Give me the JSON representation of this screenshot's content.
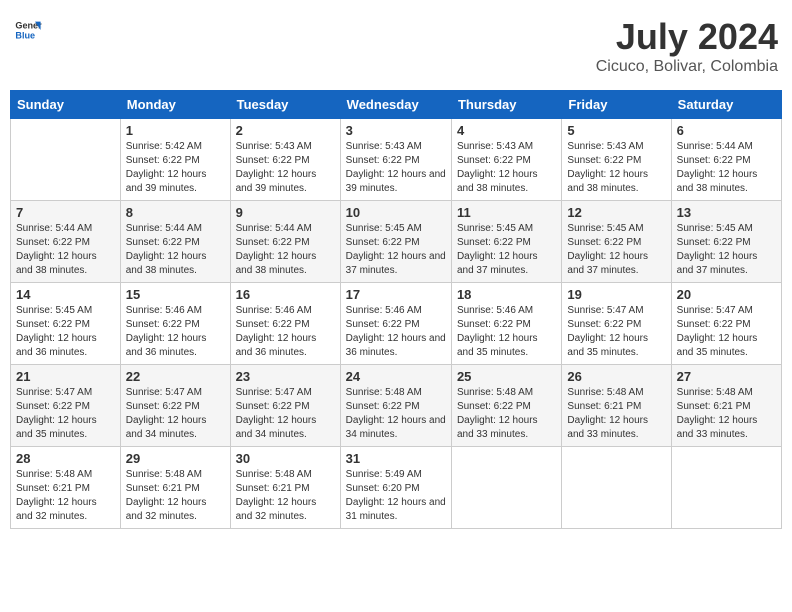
{
  "header": {
    "logo_general": "General",
    "logo_blue": "Blue",
    "month_year": "July 2024",
    "location": "Cicuco, Bolivar, Colombia"
  },
  "calendar": {
    "days_of_week": [
      "Sunday",
      "Monday",
      "Tuesday",
      "Wednesday",
      "Thursday",
      "Friday",
      "Saturday"
    ],
    "weeks": [
      [
        {
          "day": "",
          "info": ""
        },
        {
          "day": "1",
          "info": "Sunrise: 5:42 AM\nSunset: 6:22 PM\nDaylight: 12 hours\nand 39 minutes."
        },
        {
          "day": "2",
          "info": "Sunrise: 5:43 AM\nSunset: 6:22 PM\nDaylight: 12 hours\nand 39 minutes."
        },
        {
          "day": "3",
          "info": "Sunrise: 5:43 AM\nSunset: 6:22 PM\nDaylight: 12 hours\nand 39 minutes."
        },
        {
          "day": "4",
          "info": "Sunrise: 5:43 AM\nSunset: 6:22 PM\nDaylight: 12 hours\nand 38 minutes."
        },
        {
          "day": "5",
          "info": "Sunrise: 5:43 AM\nSunset: 6:22 PM\nDaylight: 12 hours\nand 38 minutes."
        },
        {
          "day": "6",
          "info": "Sunrise: 5:44 AM\nSunset: 6:22 PM\nDaylight: 12 hours\nand 38 minutes."
        }
      ],
      [
        {
          "day": "7",
          "info": "Sunrise: 5:44 AM\nSunset: 6:22 PM\nDaylight: 12 hours\nand 38 minutes."
        },
        {
          "day": "8",
          "info": "Sunrise: 5:44 AM\nSunset: 6:22 PM\nDaylight: 12 hours\nand 38 minutes."
        },
        {
          "day": "9",
          "info": "Sunrise: 5:44 AM\nSunset: 6:22 PM\nDaylight: 12 hours\nand 38 minutes."
        },
        {
          "day": "10",
          "info": "Sunrise: 5:45 AM\nSunset: 6:22 PM\nDaylight: 12 hours\nand 37 minutes."
        },
        {
          "day": "11",
          "info": "Sunrise: 5:45 AM\nSunset: 6:22 PM\nDaylight: 12 hours\nand 37 minutes."
        },
        {
          "day": "12",
          "info": "Sunrise: 5:45 AM\nSunset: 6:22 PM\nDaylight: 12 hours\nand 37 minutes."
        },
        {
          "day": "13",
          "info": "Sunrise: 5:45 AM\nSunset: 6:22 PM\nDaylight: 12 hours\nand 37 minutes."
        }
      ],
      [
        {
          "day": "14",
          "info": "Sunrise: 5:45 AM\nSunset: 6:22 PM\nDaylight: 12 hours\nand 36 minutes."
        },
        {
          "day": "15",
          "info": "Sunrise: 5:46 AM\nSunset: 6:22 PM\nDaylight: 12 hours\nand 36 minutes."
        },
        {
          "day": "16",
          "info": "Sunrise: 5:46 AM\nSunset: 6:22 PM\nDaylight: 12 hours\nand 36 minutes."
        },
        {
          "day": "17",
          "info": "Sunrise: 5:46 AM\nSunset: 6:22 PM\nDaylight: 12 hours\nand 36 minutes."
        },
        {
          "day": "18",
          "info": "Sunrise: 5:46 AM\nSunset: 6:22 PM\nDaylight: 12 hours\nand 35 minutes."
        },
        {
          "day": "19",
          "info": "Sunrise: 5:47 AM\nSunset: 6:22 PM\nDaylight: 12 hours\nand 35 minutes."
        },
        {
          "day": "20",
          "info": "Sunrise: 5:47 AM\nSunset: 6:22 PM\nDaylight: 12 hours\nand 35 minutes."
        }
      ],
      [
        {
          "day": "21",
          "info": "Sunrise: 5:47 AM\nSunset: 6:22 PM\nDaylight: 12 hours\nand 35 minutes."
        },
        {
          "day": "22",
          "info": "Sunrise: 5:47 AM\nSunset: 6:22 PM\nDaylight: 12 hours\nand 34 minutes."
        },
        {
          "day": "23",
          "info": "Sunrise: 5:47 AM\nSunset: 6:22 PM\nDaylight: 12 hours\nand 34 minutes."
        },
        {
          "day": "24",
          "info": "Sunrise: 5:48 AM\nSunset: 6:22 PM\nDaylight: 12 hours\nand 34 minutes."
        },
        {
          "day": "25",
          "info": "Sunrise: 5:48 AM\nSunset: 6:22 PM\nDaylight: 12 hours\nand 33 minutes."
        },
        {
          "day": "26",
          "info": "Sunrise: 5:48 AM\nSunset: 6:21 PM\nDaylight: 12 hours\nand 33 minutes."
        },
        {
          "day": "27",
          "info": "Sunrise: 5:48 AM\nSunset: 6:21 PM\nDaylight: 12 hours\nand 33 minutes."
        }
      ],
      [
        {
          "day": "28",
          "info": "Sunrise: 5:48 AM\nSunset: 6:21 PM\nDaylight: 12 hours\nand 32 minutes."
        },
        {
          "day": "29",
          "info": "Sunrise: 5:48 AM\nSunset: 6:21 PM\nDaylight: 12 hours\nand 32 minutes."
        },
        {
          "day": "30",
          "info": "Sunrise: 5:48 AM\nSunset: 6:21 PM\nDaylight: 12 hours\nand 32 minutes."
        },
        {
          "day": "31",
          "info": "Sunrise: 5:49 AM\nSunset: 6:20 PM\nDaylight: 12 hours\nand 31 minutes."
        },
        {
          "day": "",
          "info": ""
        },
        {
          "day": "",
          "info": ""
        },
        {
          "day": "",
          "info": ""
        }
      ]
    ]
  }
}
